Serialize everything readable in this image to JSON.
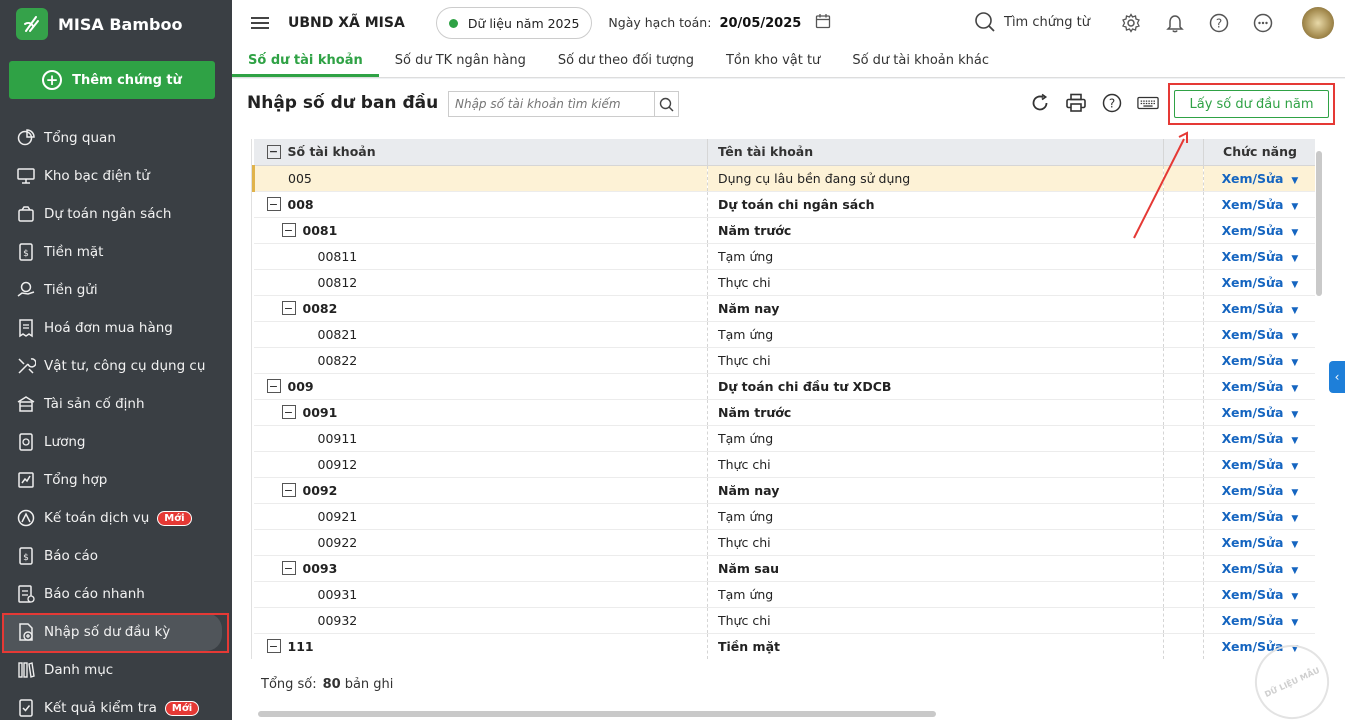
{
  "app": {
    "brand": "MISA Bamboo",
    "add_button": "Thêm chứng từ"
  },
  "sidebar": {
    "items": [
      {
        "label": "Tổng quan",
        "icon": "chart-pie-icon"
      },
      {
        "label": "Kho bạc điện tử",
        "icon": "monitor-icon"
      },
      {
        "label": "Dự toán ngân sách",
        "icon": "budget-icon"
      },
      {
        "label": "Tiền mặt",
        "icon": "cash-icon"
      },
      {
        "label": "Tiền gửi",
        "icon": "deposit-icon"
      },
      {
        "label": "Hoá đơn mua hàng",
        "icon": "invoice-icon"
      },
      {
        "label": "Vật tư, công cụ dụng cụ",
        "icon": "tools-icon"
      },
      {
        "label": "Tài sản cố định",
        "icon": "building-icon"
      },
      {
        "label": "Lương",
        "icon": "salary-icon"
      },
      {
        "label": "Tổng hợp",
        "icon": "summary-icon"
      },
      {
        "label": "Kế toán dịch vụ",
        "icon": "service-icon",
        "badge": "Mới"
      },
      {
        "label": "Báo cáo",
        "icon": "report-icon"
      },
      {
        "label": "Báo cáo nhanh",
        "icon": "quick-report-icon"
      },
      {
        "label": "Nhập số dư đầu kỳ",
        "icon": "opening-balance-icon",
        "active": true
      },
      {
        "label": "Danh mục",
        "icon": "catalog-icon"
      },
      {
        "label": "Kết quả kiểm tra",
        "icon": "check-result-icon",
        "badge": "Mới"
      }
    ]
  },
  "topbar": {
    "org": "UBND XÃ MISA",
    "year": "Dữ liệu năm 2025",
    "post_date_label": "Ngày hạch toán:",
    "post_date": "20/05/2025",
    "search": "Tìm chứng từ"
  },
  "tabs": [
    "Số dư tài khoản",
    "Số dư TK ngân hàng",
    "Số dư theo đối tượng",
    "Tồn kho vật tư",
    "Số dư tài khoản khác"
  ],
  "page": {
    "title": "Nhập số dư ban đầu",
    "search_placeholder": "Nhập số tài khoản tìm kiếm",
    "get_button": "Lấy số dư đầu năm"
  },
  "table": {
    "headers": [
      "Số tài khoản",
      "Tên tài khoản",
      "",
      "Chức năng"
    ],
    "action_label": "Xem/Sửa",
    "rows": [
      {
        "code": "005",
        "name": "Dụng cụ lâu bền đang sử dụng",
        "level": 0,
        "group": false,
        "highlight": true
      },
      {
        "code": "008",
        "name": "Dự toán chi ngân sách",
        "level": 0,
        "group": true
      },
      {
        "code": "0081",
        "name": "Năm trước",
        "level": 1,
        "group": true
      },
      {
        "code": "00811",
        "name": "Tạm ứng",
        "level": 2,
        "group": false
      },
      {
        "code": "00812",
        "name": "Thực chi",
        "level": 2,
        "group": false
      },
      {
        "code": "0082",
        "name": "Năm nay",
        "level": 1,
        "group": true
      },
      {
        "code": "00821",
        "name": "Tạm ứng",
        "level": 2,
        "group": false
      },
      {
        "code": "00822",
        "name": "Thực chi",
        "level": 2,
        "group": false
      },
      {
        "code": "009",
        "name": "Dự toán chi đầu tư XDCB",
        "level": 0,
        "group": true
      },
      {
        "code": "0091",
        "name": "Năm trước",
        "level": 1,
        "group": true
      },
      {
        "code": "00911",
        "name": "Tạm ứng",
        "level": 2,
        "group": false
      },
      {
        "code": "00912",
        "name": "Thực chi",
        "level": 2,
        "group": false
      },
      {
        "code": "0092",
        "name": "Năm nay",
        "level": 1,
        "group": true
      },
      {
        "code": "00921",
        "name": "Tạm ứng",
        "level": 2,
        "group": false
      },
      {
        "code": "00922",
        "name": "Thực chi",
        "level": 2,
        "group": false
      },
      {
        "code": "0093",
        "name": "Năm sau",
        "level": 1,
        "group": true
      },
      {
        "code": "00931",
        "name": "Tạm ứng",
        "level": 2,
        "group": false
      },
      {
        "code": "00932",
        "name": "Thực chi",
        "level": 2,
        "group": false
      },
      {
        "code": "111",
        "name": "Tiền mặt",
        "level": 0,
        "group": true
      }
    ]
  },
  "footer": {
    "total_label": "Tổng số:",
    "total_count": "80",
    "total_suffix": "bản ghi"
  },
  "watermark": "DỮ LIỆU MẪU"
}
